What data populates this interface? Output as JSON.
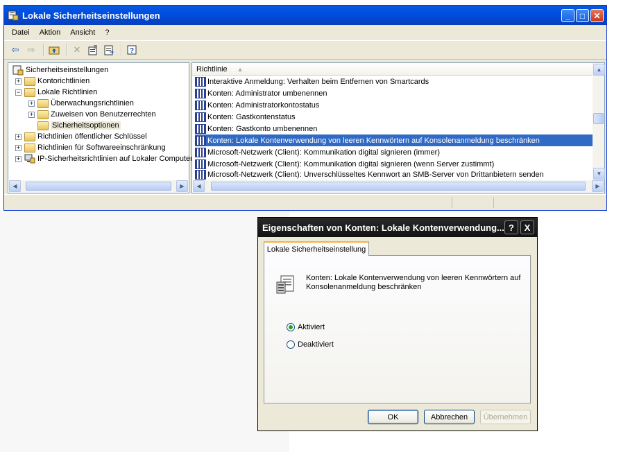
{
  "main_window": {
    "title": "Lokale Sicherheitseinstellungen",
    "menu": [
      "Datei",
      "Aktion",
      "Ansicht",
      "?"
    ],
    "toolbar_icons": [
      "back-icon",
      "forward-icon",
      "up-folder-icon",
      "delete-icon",
      "properties-icon",
      "export-list-icon",
      "help-icon"
    ]
  },
  "tree": [
    {
      "label": "Sicherheitseinstellungen",
      "level": 0,
      "expander": ""
    },
    {
      "label": "Kontorichtlinien",
      "level": 1,
      "expander": "+"
    },
    {
      "label": "Lokale Richtlinien",
      "level": 1,
      "expander": "−"
    },
    {
      "label": "Überwachungsrichtlinien",
      "level": 2,
      "expander": "+"
    },
    {
      "label": "Zuweisen von Benutzerrechten",
      "level": 2,
      "expander": "+"
    },
    {
      "label": "Sicherheitsoptionen",
      "level": 2,
      "expander": ""
    },
    {
      "label": "Richtlinien öffentlicher Schlüssel",
      "level": 1,
      "expander": "+"
    },
    {
      "label": "Richtlinien für Softwareeinschränkung",
      "level": 1,
      "expander": "+"
    },
    {
      "label": "IP-Sicherheitsrichtlinien auf Lokaler Computer",
      "level": 1,
      "expander": "+"
    }
  ],
  "list": {
    "column_header": "Richtlinie",
    "rows": [
      "Interaktive Anmeldung: Verhalten beim Entfernen von Smartcards",
      "Konten: Administrator umbenennen",
      "Konten: Administratorkontostatus",
      "Konten: Gastkontenstatus",
      "Konten: Gastkonto umbenennen",
      "Konten: Lokale Kontenverwendung von leeren Kennwörtern auf Konsolenanmeldung beschränken",
      "Microsoft-Netzwerk (Client): Kommunikation digital signieren (immer)",
      "Microsoft-Netzwerk (Client): Kommunikation digital signieren (wenn Server zustimmt)",
      "Microsoft-Netzwerk (Client): Unverschlüsseltes Kennwort an SMB-Server von Drittanbietern senden"
    ],
    "selected_index": 5
  },
  "dialog": {
    "title": "Eigenschaften von Konten: Lokale Kontenverwendung...",
    "help_button": "?",
    "close_button": "X",
    "tab_label": "Lokale Sicherheitseinstellung",
    "description_line1": "Konten: Lokale Kontenverwendung von leeren Kennwörtern auf",
    "description_line2": "Konsolenanmeldung beschränken",
    "option_enabled": "Aktiviert",
    "option_disabled": "Deaktiviert",
    "selected_option": "Aktiviert",
    "ok_label": "OK",
    "cancel_label": "Abbrechen",
    "apply_label": "Übernehmen"
  }
}
